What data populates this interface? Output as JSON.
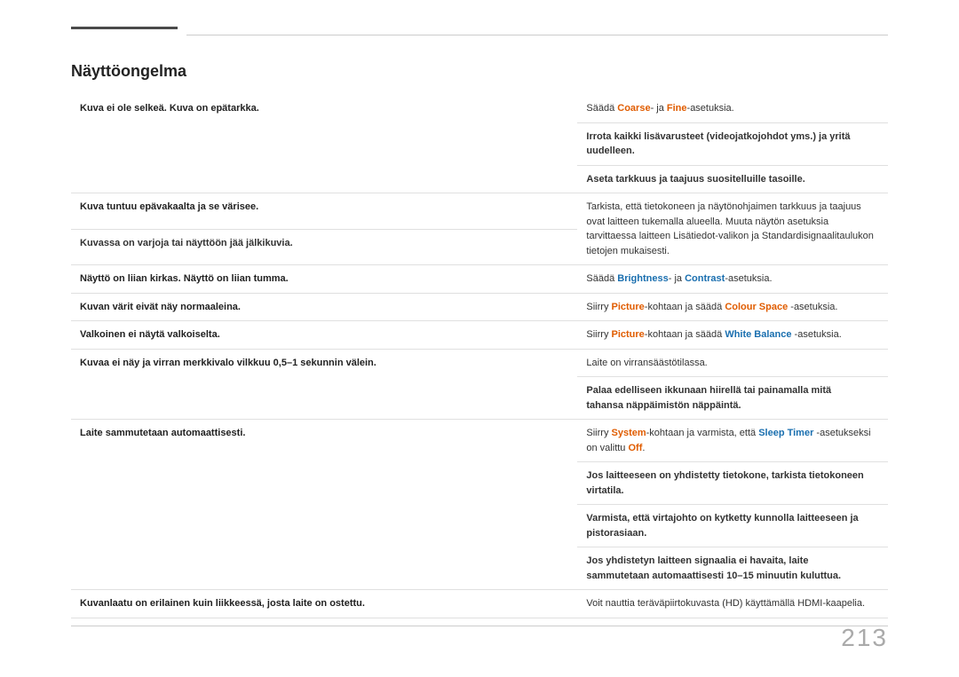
{
  "page": {
    "title": "Näyttöongelma",
    "page_number": "213",
    "accent_line": true
  },
  "table": {
    "rows": [
      {
        "id": "row1",
        "left": "Kuva ei ole selkeä. Kuva on epätarkka.",
        "right_cells": [
          {
            "text_parts": [
              {
                "text": "Säädä ",
                "style": "normal"
              },
              {
                "text": "Coarse",
                "style": "orange"
              },
              {
                "text": "- ja ",
                "style": "normal"
              },
              {
                "text": "Fine",
                "style": "orange"
              },
              {
                "text": "-asetuksia.",
                "style": "normal"
              }
            ]
          },
          {
            "text_parts": [
              {
                "text": "Irrota kaikki lisävarusteet (videojatkojohdot yms.) ja yritä uudelleen.",
                "style": "normal"
              }
            ]
          },
          {
            "text_parts": [
              {
                "text": "Aseta tarkkuus ja taajuus suositelluille tasoille.",
                "style": "normal"
              }
            ]
          }
        ]
      },
      {
        "id": "row2",
        "left": "Kuva tuntuu epävakaalta ja se värisee.",
        "right_cells": [
          {
            "text_parts": [
              {
                "text": "Tarkista, että tietokoneen ja näytönohjaimen tarkkuus ja taajuus ovat laitteen tukemalla alueella. Muuta näytön asetuksia tarvittaessa laitteen Lisätiedot-valikon ja Standardisignaalitaulukon tietojen mukaisesti.",
                "style": "normal"
              }
            ],
            "rowspan": 2
          }
        ]
      },
      {
        "id": "row2b",
        "left": "Kuvassa on varjoja tai näyttöön jää jälkikuvia.",
        "right_cells": []
      },
      {
        "id": "row3",
        "left": "Näyttö on liian kirkas. Näyttö on liian tumma.",
        "right_cells": [
          {
            "text_parts": [
              {
                "text": "Säädä ",
                "style": "normal"
              },
              {
                "text": "Brightness",
                "style": "blue"
              },
              {
                "text": "- ja ",
                "style": "normal"
              },
              {
                "text": "Contrast",
                "style": "blue"
              },
              {
                "text": "-asetuksia.",
                "style": "normal"
              }
            ]
          }
        ]
      },
      {
        "id": "row4",
        "left": "Kuvan värit eivät näy normaaleina.",
        "right_cells": [
          {
            "text_parts": [
              {
                "text": "Siirry ",
                "style": "normal"
              },
              {
                "text": "Picture",
                "style": "orange"
              },
              {
                "text": "-kohtaan ja säädä ",
                "style": "normal"
              },
              {
                "text": "Colour Space",
                "style": "orange"
              },
              {
                "text": " -asetuksia.",
                "style": "normal"
              }
            ]
          }
        ]
      },
      {
        "id": "row5",
        "left": "Valkoinen ei näytä valkoiselta.",
        "right_cells": [
          {
            "text_parts": [
              {
                "text": "Siirry ",
                "style": "normal"
              },
              {
                "text": "Picture",
                "style": "orange"
              },
              {
                "text": "-kohtaan ja säädä ",
                "style": "normal"
              },
              {
                "text": "White Balance",
                "style": "blue"
              },
              {
                "text": " -asetuksia.",
                "style": "normal"
              }
            ]
          }
        ]
      },
      {
        "id": "row6",
        "left": "Kuvaa ei näy ja virran merkkivalo vilkkuu 0,5–1 sekunnin välein.",
        "right_cells": [
          {
            "text_parts": [
              {
                "text": "Laite on virransäästötilassa.",
                "style": "normal"
              }
            ]
          },
          {
            "text_parts": [
              {
                "text": "Palaa edelliseen ikkunaan hiirellä tai painamalla mitä tahansa näppäimistön näppäintä.",
                "style": "normal"
              }
            ]
          }
        ]
      },
      {
        "id": "row7",
        "left": "Laite sammutetaan automaattisesti.",
        "right_cells": [
          {
            "text_parts": [
              {
                "text": "Siirry ",
                "style": "normal"
              },
              {
                "text": "System",
                "style": "orange"
              },
              {
                "text": "-kohtaan ja varmista, että ",
                "style": "normal"
              },
              {
                "text": "Sleep Timer",
                "style": "blue"
              },
              {
                "text": " -asetukseksi on valittu ",
                "style": "normal"
              },
              {
                "text": "Off",
                "style": "orange"
              },
              {
                "text": ".",
                "style": "normal"
              }
            ]
          },
          {
            "text_parts": [
              {
                "text": "Jos laitteeseen on yhdistetty tietokone, tarkista tietokoneen virtatila.",
                "style": "normal"
              }
            ]
          },
          {
            "text_parts": [
              {
                "text": "Varmista, että virtajohto on kytketty kunnolla laitteeseen ja pistorasiaan.",
                "style": "normal"
              }
            ]
          },
          {
            "text_parts": [
              {
                "text": "Jos yhdistetyn laitteen signaalia ei havaita, laite sammutetaan automaattisesti 10–15 minuutin kuluttua.",
                "style": "normal"
              }
            ]
          }
        ]
      },
      {
        "id": "row8",
        "left": "Kuvanlaatu on erilainen kuin liikkeessä, josta laite on ostettu.",
        "right_cells": [
          {
            "text_parts": [
              {
                "text": "Voit nauttia teräväpiirtokuvasta (HD) käyttämällä HDMI-kaapelia.",
                "style": "normal"
              }
            ]
          }
        ]
      }
    ]
  }
}
